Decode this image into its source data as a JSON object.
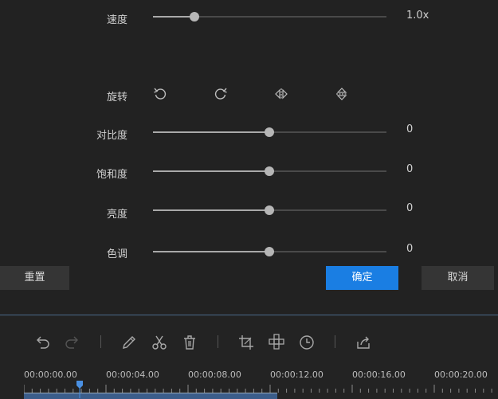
{
  "adjust": {
    "speed": {
      "label": "速度",
      "value": "1.0x",
      "level": 0.18
    },
    "rotate": {
      "label": "旋转",
      "icons": [
        "rotate-left-icon",
        "rotate-right-icon",
        "flip-horizontal-icon",
        "flip-vertical-icon"
      ]
    },
    "contrast": {
      "label": "对比度",
      "value": "0",
      "level": 0.5
    },
    "saturation": {
      "label": "饱和度",
      "value": "0",
      "level": 0.5
    },
    "brightness": {
      "label": "亮度",
      "value": "0",
      "level": 0.5
    },
    "hue": {
      "label": "色调",
      "value": "0",
      "level": 0.5
    }
  },
  "buttons": {
    "reset": "重置",
    "confirm": "确定",
    "cancel": "取消"
  },
  "toolbar": {
    "icons": [
      "undo-icon",
      "redo-icon",
      "pencil-icon",
      "scissors-icon",
      "trash-icon",
      "crop-icon",
      "mosaic-icon",
      "clock-icon",
      "export-icon"
    ]
  },
  "timeline": {
    "labels": [
      "00:00:00.00",
      "00:00:04.00",
      "00:00:08.00",
      "00:00:12.00",
      "00:00:16.00",
      "00:00:20.00"
    ]
  },
  "colors": {
    "accent": "#1a7ee3",
    "background": "#222222"
  }
}
